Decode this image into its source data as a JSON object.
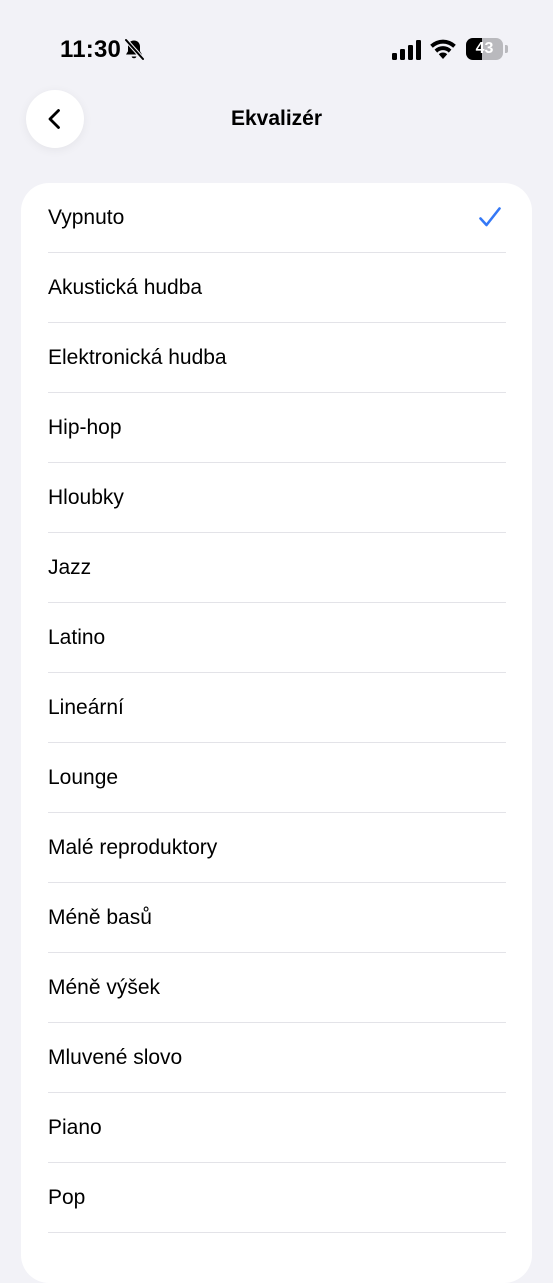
{
  "status_bar": {
    "time": "11:30",
    "battery_level": "43",
    "icons": [
      "bell-slash-icon",
      "cellular-signal-icon",
      "wifi-icon",
      "battery-icon"
    ]
  },
  "nav": {
    "title": "Ekvalizér",
    "back_icon": "chevron-left-icon"
  },
  "accent_color": "#3478f6",
  "list": {
    "selected_index": 0,
    "items": [
      {
        "label": "Vypnuto"
      },
      {
        "label": "Akustická hudba"
      },
      {
        "label": "Elektronická hudba"
      },
      {
        "label": "Hip-hop"
      },
      {
        "label": "Hloubky"
      },
      {
        "label": "Jazz"
      },
      {
        "label": "Latino"
      },
      {
        "label": "Lineární"
      },
      {
        "label": "Lounge"
      },
      {
        "label": "Malé reproduktory"
      },
      {
        "label": "Méně basů"
      },
      {
        "label": "Méně výšek"
      },
      {
        "label": "Mluvené slovo"
      },
      {
        "label": "Piano"
      },
      {
        "label": "Pop"
      }
    ]
  }
}
